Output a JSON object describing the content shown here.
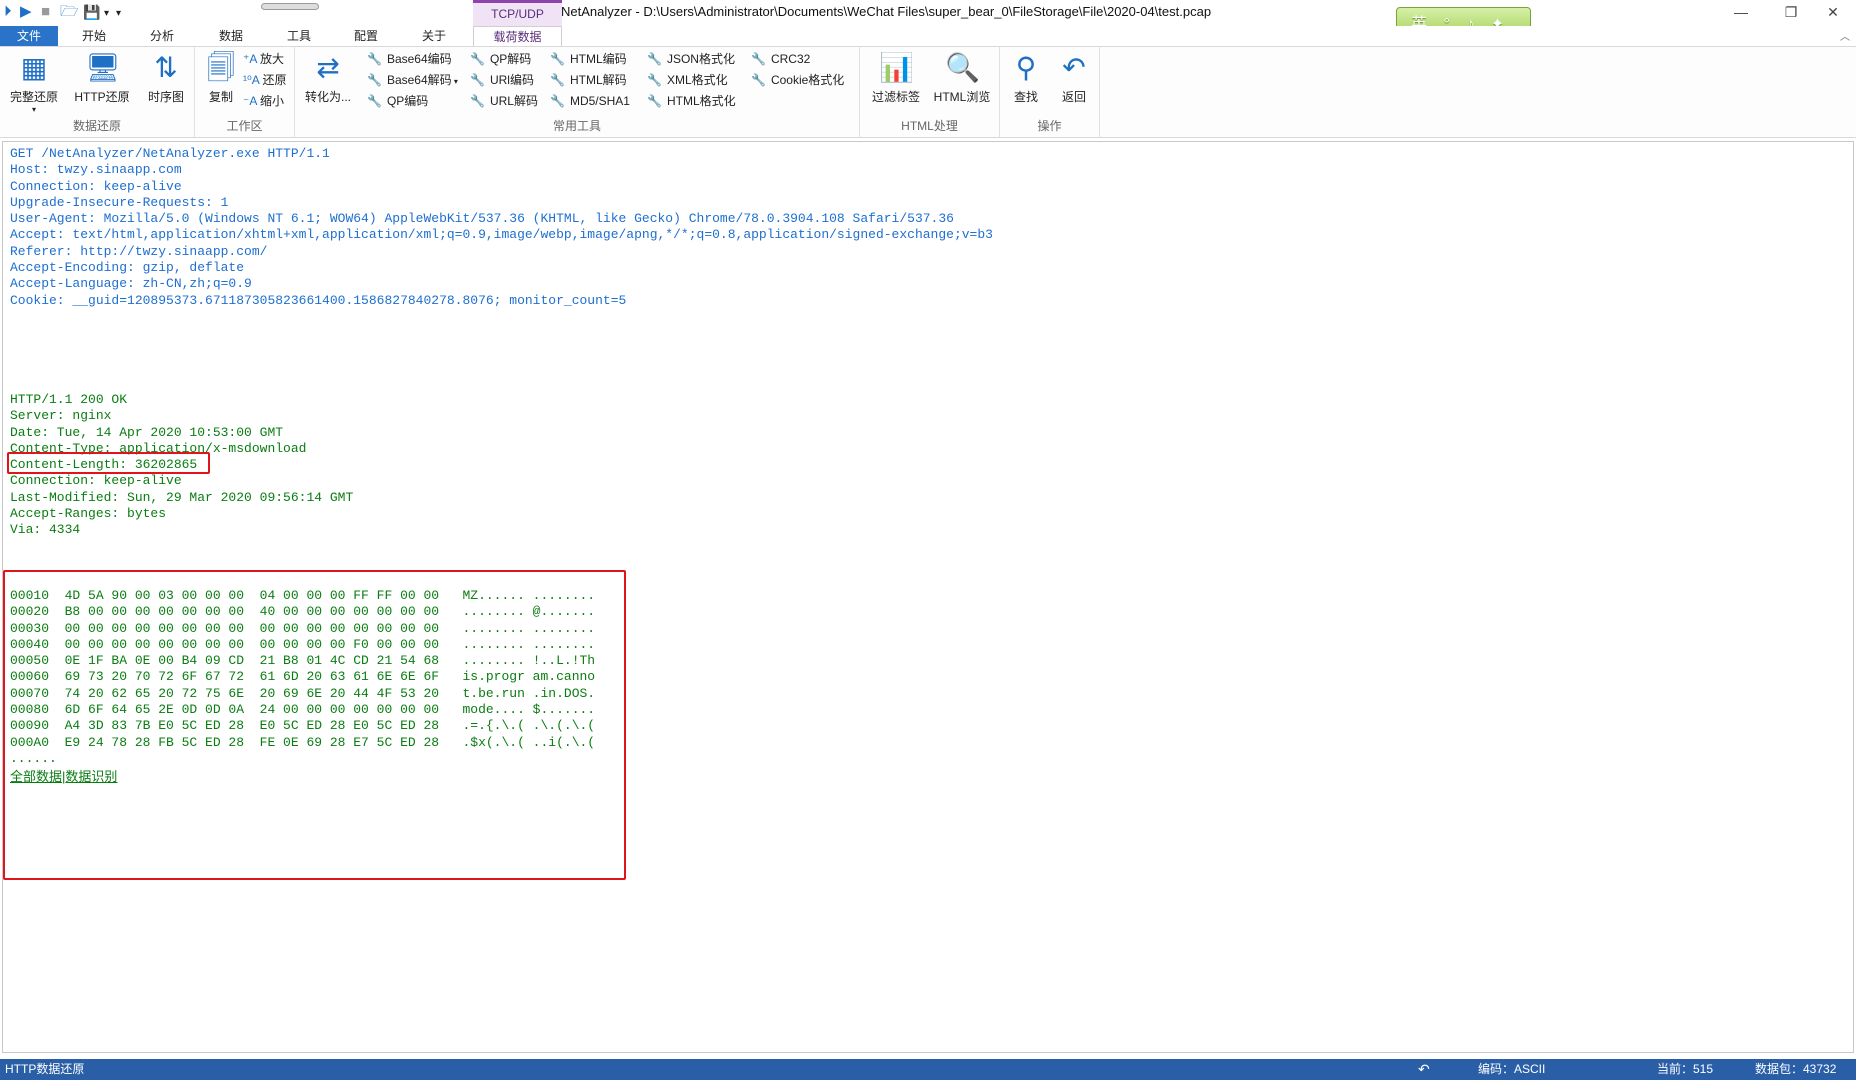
{
  "window": {
    "title": "NetAnalyzer - D:\\Users\\Administrator\\Documents\\WeChat Files\\super_bear_0\\FileStorage\\File\\2020-04\\test.pcap",
    "context_group": "TCP/UDP",
    "ime": "英 ° ♪ ✦ ☺",
    "controls": {
      "minimize": "—",
      "restore": "❐",
      "close": "✕"
    }
  },
  "quick_access": {
    "icons": [
      "filter-icon",
      "play-icon",
      "stop-icon",
      "open-icon",
      "save-icon"
    ],
    "more": "▾"
  },
  "tabs": [
    {
      "label": "文件",
      "active": true
    },
    {
      "label": "开始"
    },
    {
      "label": "分析"
    },
    {
      "label": "数据"
    },
    {
      "label": "工具"
    },
    {
      "label": "配置"
    },
    {
      "label": "关于"
    },
    {
      "label": "载荷数据",
      "context": true
    }
  ],
  "ribbon": {
    "groups": {
      "restore": {
        "label": "数据还原",
        "full_restore": "完整还原",
        "http_restore": "HTTP还原",
        "sequence": "时序图"
      },
      "workspace": {
        "label": "工作区",
        "copy": "复制",
        "zoom_in": "放大",
        "reset": "还原",
        "zoom_out": "缩小"
      },
      "convert": {
        "convert_to": "转化为..."
      },
      "tools": {
        "label": "常用工具",
        "items": [
          [
            "Base64编码",
            "Base64解码",
            "QP编码"
          ],
          [
            "QP解码",
            "URl编码",
            "URL解码"
          ],
          [
            "HTML编码",
            "HTML解码",
            "MD5/SHA1"
          ],
          [
            "JSON格式化",
            "XML格式化",
            "HTML格式化"
          ],
          [
            "CRC32",
            "Cookie格式化"
          ]
        ]
      },
      "html": {
        "label": "HTML处理",
        "filter_tags": "过滤标签",
        "html_browse": "HTML浏览"
      },
      "ops": {
        "label": "操作",
        "find": "查找",
        "back": "返回"
      }
    }
  },
  "request": [
    "GET /NetAnalyzer/NetAnalyzer.exe HTTP/1.1",
    "Host: twzy.sinaapp.com",
    "Connection: keep-alive",
    "Upgrade-Insecure-Requests: 1",
    "User-Agent: Mozilla/5.0 (Windows NT 6.1; WOW64) AppleWebKit/537.36 (KHTML, like Gecko) Chrome/78.0.3904.108 Safari/537.36",
    "Accept: text/html,application/xhtml+xml,application/xml;q=0.9,image/webp,image/apng,*/*;q=0.8,application/signed-exchange;v=b3",
    "Referer: http://twzy.sinaapp.com/",
    "Accept-Encoding: gzip, deflate",
    "Accept-Language: zh-CN,zh;q=0.9",
    "Cookie: __guid=120895373.671187305823661400.1586827840278.8076; monitor_count=5"
  ],
  "response": [
    "HTTP/1.1 200 OK",
    "Server: nginx",
    "Date: Tue, 14 Apr 2020 10:53:00 GMT",
    "Content-Type: application/x-msdownload",
    "Content-Length: 36202865",
    "Connection: keep-alive",
    "Last-Modified: Sun, 29 Mar 2020 09:56:14 GMT",
    "Accept-Ranges: bytes",
    "Via: 4334"
  ],
  "hexdump": [
    "00010  4D 5A 90 00 03 00 00 00  04 00 00 00 FF FF 00 00   MZ...... ........",
    "00020  B8 00 00 00 00 00 00 00  40 00 00 00 00 00 00 00   ........ @.......",
    "00030  00 00 00 00 00 00 00 00  00 00 00 00 00 00 00 00   ........ ........",
    "00040  00 00 00 00 00 00 00 00  00 00 00 00 F0 00 00 00   ........ ........",
    "00050  0E 1F BA 0E 00 B4 09 CD  21 B8 01 4C CD 21 54 68   ........ !..L.!Th",
    "00060  69 73 20 70 72 6F 67 72  61 6D 20 63 61 6E 6E 6F   is.progr am.canno",
    "00070  74 20 62 65 20 72 75 6E  20 69 6E 20 44 4F 53 20   t.be.run .in.DOS.",
    "00080  6D 6F 64 65 2E 0D 0D 0A  24 00 00 00 00 00 00 00   mode.... $.......",
    "00090  A4 3D 83 7B E0 5C ED 28  E0 5C ED 28 E0 5C ED 28   .=.{.\\.( .\\.(.\\.(",
    "000A0  E9 24 78 28 FB 5C ED 28  FE 0E 69 28 E7 5C ED 28   .$x(.\\.( ..i(.\\.(",
    "......"
  ],
  "hex_links": {
    "all": "全部数据",
    "sep": "|",
    "identify": "数据识别"
  },
  "status": {
    "left": "HTTP数据还原",
    "encoding": "编码：ASCII",
    "current": "当前：515",
    "packet": "数据包：43732"
  },
  "colors": {
    "accent": "#2a73c9",
    "request_text": "#1e6fd0",
    "response_text": "#0a7d12",
    "highlight": "#e0141b",
    "statusbar": "#2a5fa8"
  }
}
